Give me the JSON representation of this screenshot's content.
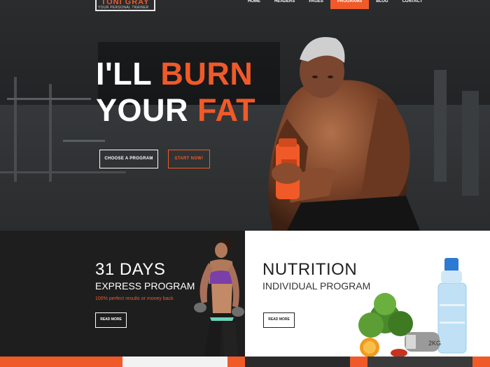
{
  "brand": {
    "name": "TONI GRAY",
    "tagline": "YOUR PERSONAL TRAINER"
  },
  "nav": {
    "items": [
      {
        "label": "HOME"
      },
      {
        "label": "HEADERS"
      },
      {
        "label": "PAGES"
      },
      {
        "label": "PROGRAMS"
      },
      {
        "label": "BLOG"
      },
      {
        "label": "CONTACT"
      }
    ],
    "active": "PROGRAMS"
  },
  "hero": {
    "line1_white": "I'LL ",
    "line1_orange": "BURN",
    "line2_white": "YOUR ",
    "line2_orange": "FAT",
    "btn_choose": "CHOOSE A PROGRAM",
    "btn_start": "START NOW!"
  },
  "program_left": {
    "title": "31 DAYS",
    "subtitle": "EXPRESS PROGRAM",
    "note": "100% perfect results or money back",
    "button": "READ MORE"
  },
  "program_right": {
    "title": "NUTRITION",
    "subtitle": "INDIVIDUAL PROGRAM",
    "button": "READ MORE",
    "weight_label": "2KG"
  },
  "colors": {
    "accent": "#f05a28",
    "dark": "#1e1e1e",
    "light": "#ffffff"
  }
}
